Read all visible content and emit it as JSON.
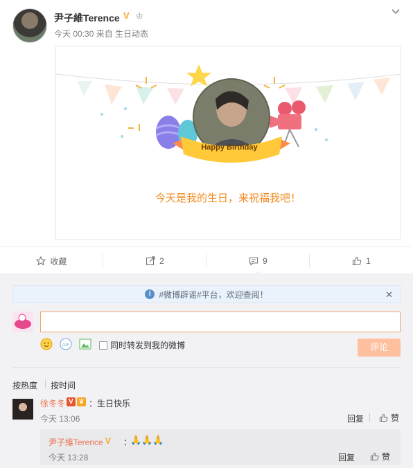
{
  "post": {
    "user_name": "尹子維Terence",
    "verified_badge": "V",
    "meta": "今天 00:30 来自 生日动态",
    "card": {
      "badge_label": "Happy Birthday",
      "message": "今天是我的生日，来祝福我吧！"
    }
  },
  "actions": {
    "favorite_label": "收藏",
    "repost_count": "2",
    "comment_count": "9",
    "like_count": "1"
  },
  "comments": {
    "notice": "#微博辟谣#平台，欢迎查阅！",
    "input_value": "",
    "repost_checkbox_label": "同时转发到我的微博",
    "submit_label": "评论",
    "sort_hot": "按热度",
    "sort_time": "按时间",
    "list": [
      {
        "name": "徐冬冬",
        "text": "：生日快乐",
        "time": "今天 13:06",
        "reply_label": "回复",
        "like_label": "赞",
        "replies": [
          {
            "name": "尹子維Terence",
            "text": "：",
            "time": "今天 13:28",
            "reply_label": "回复",
            "like_label": "赞"
          }
        ]
      }
    ]
  },
  "colors": {
    "accent_orange": "#f38a1f",
    "link_name": "#eb7350",
    "verified": "#f5a623",
    "submit_disabled": "#ffc09f"
  }
}
